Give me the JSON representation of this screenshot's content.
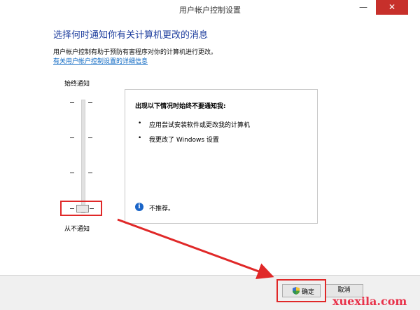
{
  "window": {
    "title": "用户帐户控制设置",
    "minimize_glyph": "—",
    "close_glyph": "✕"
  },
  "main": {
    "heading": "选择何时通知你有关计算机更改的消息",
    "description": "用户帐户控制有助于预防有害程序对你的计算机进行更改。",
    "link": "有关用户帐户控制设置的详细信息"
  },
  "slider": {
    "top_label": "始终通知",
    "bottom_label": "从不通知",
    "level": 0,
    "levels": 4
  },
  "panel": {
    "title": "出现以下情况时始终不要通知我:",
    "bullets": [
      "应用尝试安装软件或更改我的计算机",
      "我更改了 Windows 设置"
    ],
    "info_icon": "info-icon",
    "info_text": "不推荐。"
  },
  "buttons": {
    "ok": "确定",
    "cancel": "取消"
  },
  "watermark": "xuexila.com",
  "colors": {
    "heading": "#1e3e9e",
    "link": "#0a66c2",
    "highlight": "#e02828",
    "info": "#1a65c8"
  }
}
